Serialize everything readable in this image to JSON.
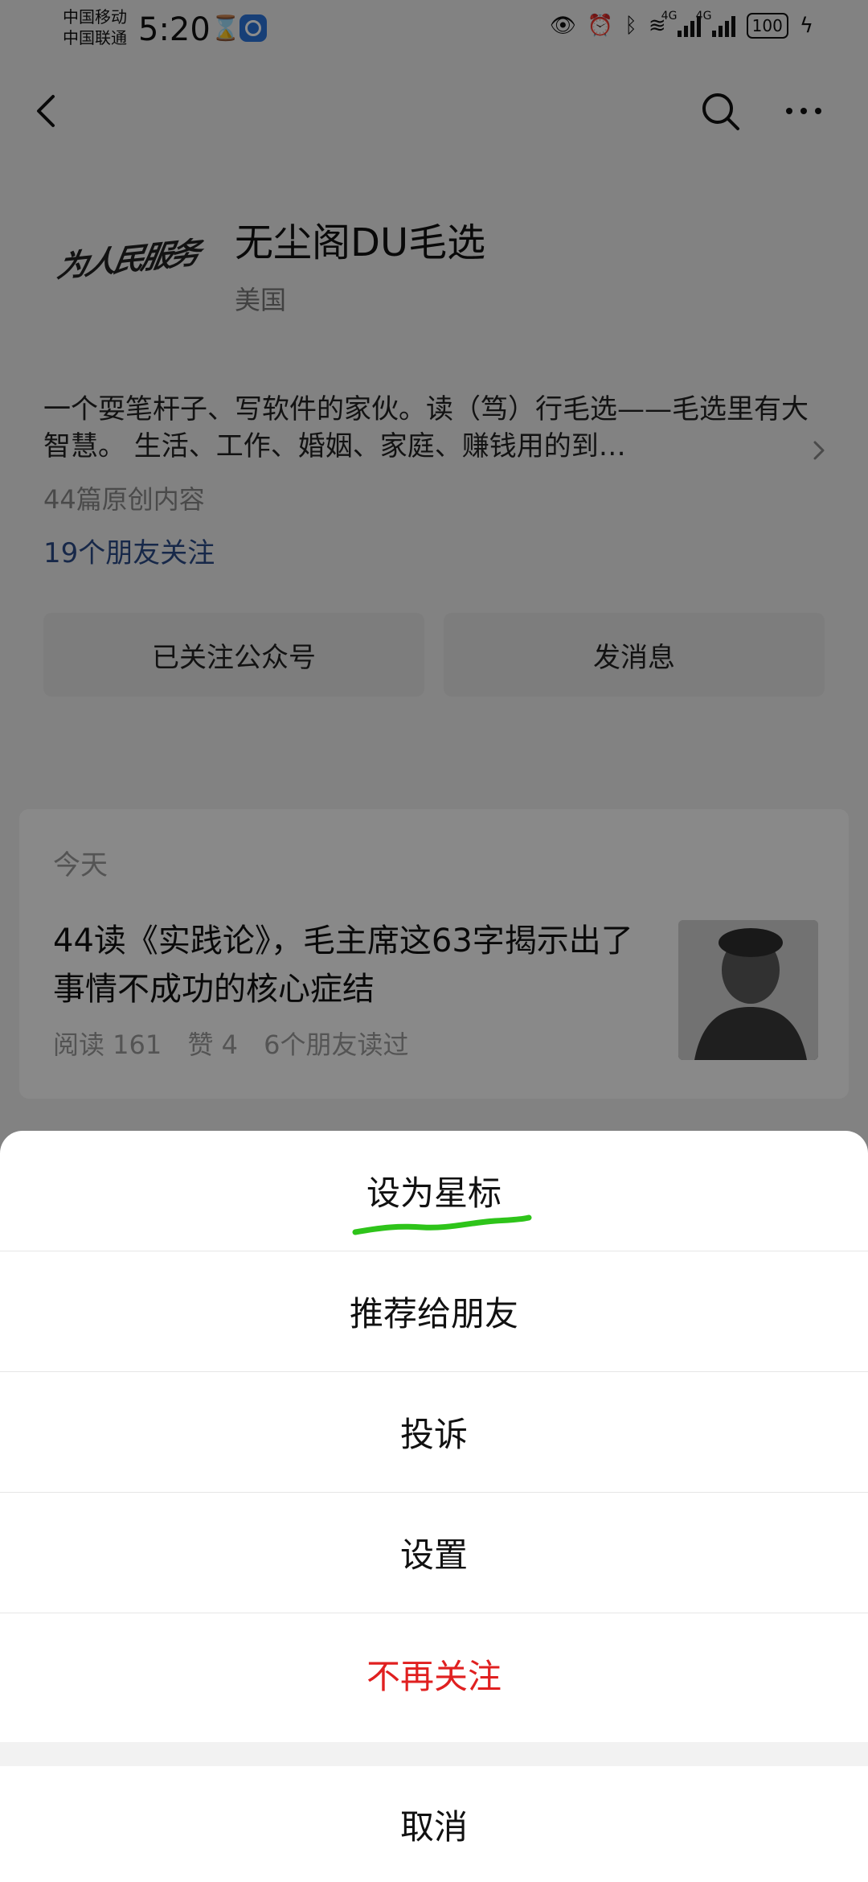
{
  "status_bar": {
    "carrier1": "中国移动",
    "carrier2": "中国联通",
    "time": "5:20",
    "net1": "4G",
    "net2": "4G",
    "battery": "100"
  },
  "account": {
    "logo_text": "为人民服务",
    "name": "无尘阁DU毛选",
    "region": "美国",
    "description": "一个耍笔杆子、写软件的家伙。读（笃）行毛选——毛选里有大智慧。 生活、工作、婚姻、家庭、赚钱用的到…",
    "original_count": "44篇原创内容",
    "friends_following": "19个朋友关注",
    "followed_button": "已关注公众号",
    "message_button": "发消息"
  },
  "article": {
    "date": "今天",
    "title": "44读《实践论》，毛主席这63字揭示出了事情不成功的核心症结",
    "reads": "阅读 161",
    "likes": "赞 4",
    "friends_read": "6个朋友读过"
  },
  "action_sheet": {
    "star": "设为星标",
    "recommend": "推荐给朋友",
    "report": "投诉",
    "settings": "设置",
    "unfollow": "不再关注",
    "cancel": "取消"
  },
  "colors": {
    "danger": "#e02020",
    "link": "#2b4a86",
    "annotation": "#2ec41a"
  }
}
